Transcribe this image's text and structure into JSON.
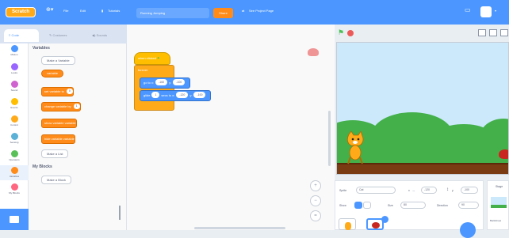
{
  "menu": {
    "logo": "Scratch",
    "items": [
      "File",
      "Edit"
    ],
    "tutorials": "Tutorials",
    "project_title": "Running Jumping",
    "share": "Share",
    "see_project_page": "See Project Page"
  },
  "tabs": [
    "Code",
    "Costumes",
    "Sounds"
  ],
  "categories": [
    {
      "label": "Motion",
      "color": "#4c97ff"
    },
    {
      "label": "Looks",
      "color": "#9966ff"
    },
    {
      "label": "Sound",
      "color": "#cf63cf"
    },
    {
      "label": "Events",
      "color": "#ffbf00"
    },
    {
      "label": "Control",
      "color": "#ffab19"
    },
    {
      "label": "Sensing",
      "color": "#5cb1d6"
    },
    {
      "label": "Operators",
      "color": "#59c059"
    },
    {
      "label": "Variables",
      "color": "#ff8c1a"
    },
    {
      "label": "My Blocks",
      "color": "#ff6680"
    }
  ],
  "palette": {
    "variables_heading": "Variables",
    "make_variable": "Make a Variable",
    "variable_name": "variable",
    "set_block": "set variable to",
    "set_value": "0",
    "change_block": "change variable by",
    "change_value": "1",
    "show_block": "show variable variable",
    "hide_block": "hide variable variable",
    "make_list": "Make a List",
    "myblocks_heading": "My Blocks",
    "make_block": "Make a Block"
  },
  "script": {
    "hat": "when clicked",
    "forever": "forever",
    "goto": "go to x:",
    "goto_x": "-160",
    "goto_y_label": "y:",
    "goto_y": "-100",
    "glide": "glide",
    "glide_secs": "1",
    "glide_to": "secs to x:",
    "glide_x": "-120",
    "glide_y_label": "y:",
    "glide_y": "-100"
  },
  "zoom": {
    "in": "+",
    "out": "−",
    "reset": "="
  },
  "sprite_info": {
    "sprite_label": "Sprite",
    "sprite_name": "Cat",
    "x_label": "x",
    "x_value": "-120",
    "y_label": "y",
    "y_value": "-100",
    "show_label": "Show",
    "size_label": "Size",
    "size_value": "80",
    "direction_label": "Direction",
    "direction_value": "90"
  },
  "stage_pane": {
    "label": "Stage",
    "backdrops_label": "Backdrops"
  },
  "colors": {
    "accent": "#4c97ff",
    "variables": "#ff8c1a",
    "events": "#ffbf00",
    "control": "#ffab19",
    "ground": "#7a3b12",
    "grass": "#44b04a"
  }
}
